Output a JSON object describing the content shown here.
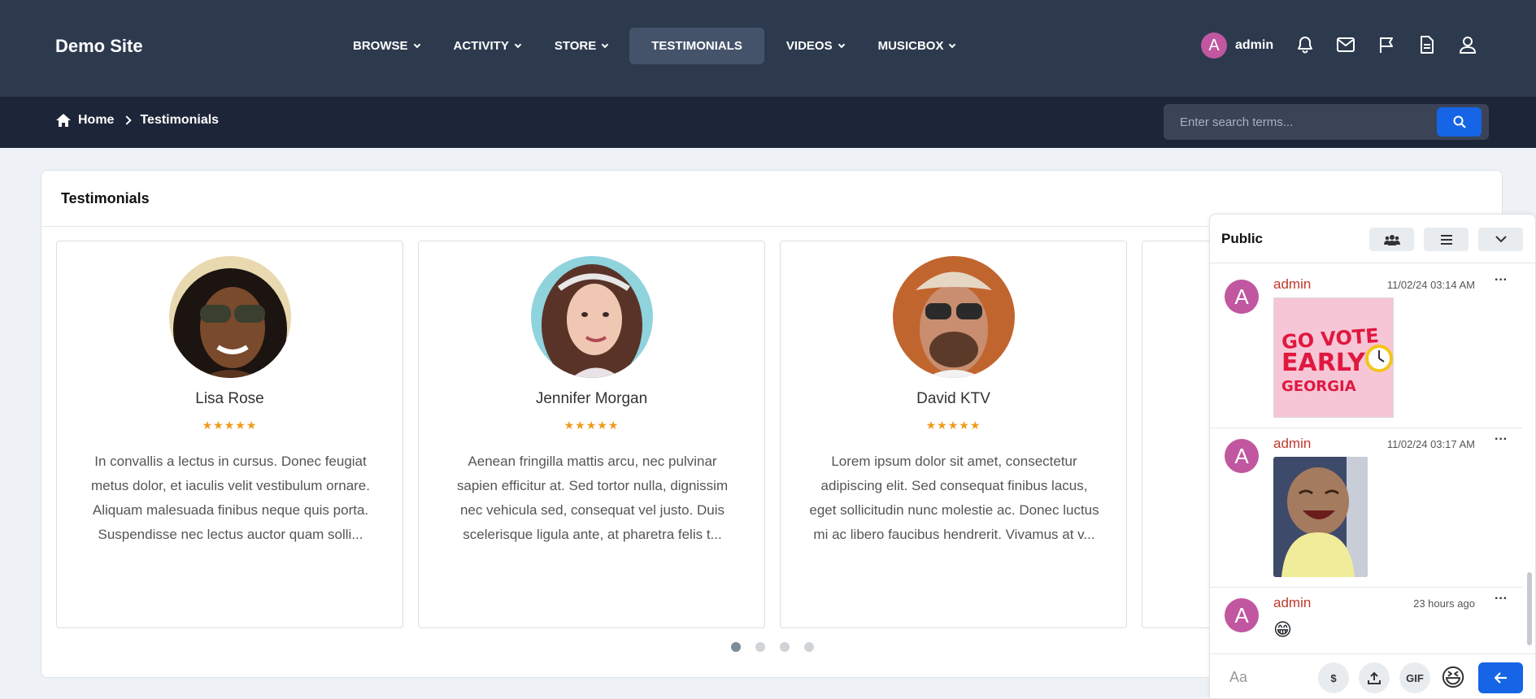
{
  "brand": "Demo Site",
  "nav": {
    "items": [
      {
        "label": "BROWSE",
        "caret": true
      },
      {
        "label": "ACTIVITY",
        "caret": true
      },
      {
        "label": "STORE",
        "caret": true
      },
      {
        "label": "TESTIMONIALS",
        "caret": false,
        "active": true
      },
      {
        "label": "VIDEOS",
        "caret": true
      },
      {
        "label": "MUSICBOX",
        "caret": true
      }
    ],
    "user": {
      "initial": "A",
      "name": "admin"
    },
    "icons": [
      "bell-icon",
      "mail-icon",
      "flag-icon",
      "document-icon",
      "user-icon"
    ]
  },
  "breadcrumb": {
    "home": "Home",
    "current": "Testimonials"
  },
  "search": {
    "placeholder": "Enter search terms..."
  },
  "panel": {
    "title": "Testimonials"
  },
  "testimonials": [
    {
      "name": "Lisa Rose",
      "stars": "★★★★★",
      "text": "In convallis a lectus in cursus. Donec feugiat metus dolor, et iaculis velit vestibulum ornare. Aliquam malesuada finibus neque quis porta. Suspendisse nec lectus auctor quam solli..."
    },
    {
      "name": "Jennifer Morgan",
      "stars": "★★★★★",
      "text": "Aenean fringilla mattis arcu, nec pulvinar sapien efficitur at. Sed tortor nulla, dignissim nec vehicula sed, consequat vel justo. Duis scelerisque ligula ante, at pharetra felis t..."
    },
    {
      "name": "David KTV",
      "stars": "★★★★★",
      "text": "Lorem ipsum dolor sit amet, consectetur adipiscing elit. Sed consequat finibus lacus, eget sollicitudin nunc molestie ac. Donec luctus mi ac libero faucibus hendrerit. Vivamus at v..."
    }
  ],
  "chat": {
    "title": "Public",
    "messages": [
      {
        "initial": "A",
        "author": "admin",
        "time": "11/02/24 03:14 AM",
        "more": "···",
        "sticker": {
          "line1": "GO VOTE",
          "line2": "EARLY",
          "line3": "GEORGIA"
        }
      },
      {
        "initial": "A",
        "author": "admin",
        "time": "11/02/24 03:17 AM",
        "more": "···"
      },
      {
        "initial": "A",
        "author": "admin",
        "time": "23 hours ago",
        "more": "···",
        "emoji": "😁"
      }
    ],
    "composer": {
      "placeholder": "Aa",
      "dollar": "$",
      "gif": "GIF",
      "emoji": "😆"
    }
  }
}
